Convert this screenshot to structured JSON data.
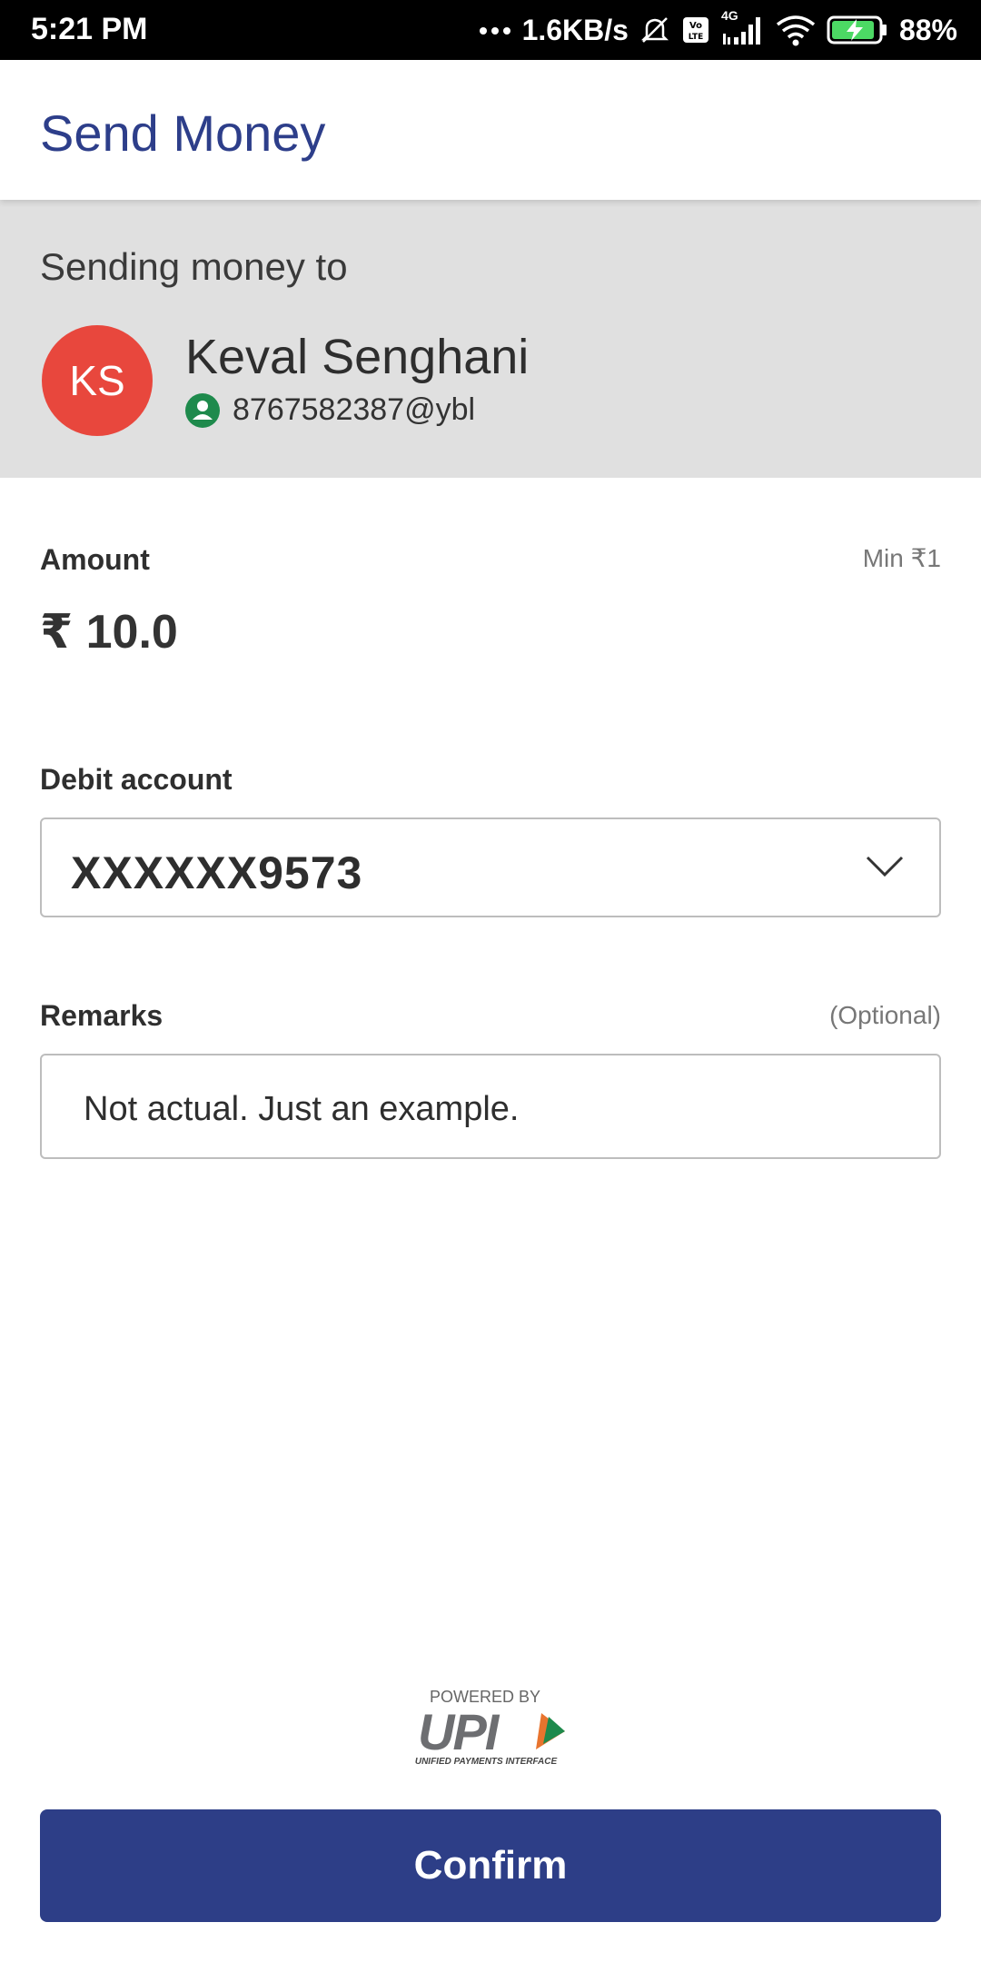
{
  "status_bar": {
    "time": "5:21 PM",
    "network_speed": "1.6KB/s",
    "battery": "88%",
    "network_type": "4G",
    "icons": [
      "dots-icon",
      "mute-icon",
      "volte-icon",
      "signal-icon",
      "wifi-icon",
      "battery-charging-icon"
    ]
  },
  "app_bar": {
    "title": "Send Money"
  },
  "recipient": {
    "heading": "Sending money to",
    "initials": "KS",
    "name": "Keval Senghani",
    "vpa": "8767582387@ybl",
    "avatar_color": "#e8473d"
  },
  "amount": {
    "label": "Amount",
    "min_hint": "Min ₹1",
    "value": "₹ 10.0"
  },
  "debit_account": {
    "label": "Debit account",
    "selected": "XXXXXX9573"
  },
  "remarks": {
    "label": "Remarks",
    "optional_hint": "(Optional)",
    "value": "Not actual. Just an example."
  },
  "upi": {
    "powered_by": "POWERED BY",
    "wordmark": "UPI",
    "subtitle": "UNIFIED PAYMENTS INTERFACE"
  },
  "confirm_button": {
    "label": "Confirm",
    "color": "#2d3e87"
  }
}
